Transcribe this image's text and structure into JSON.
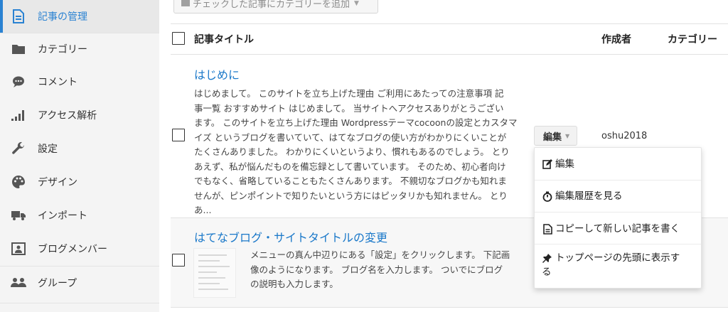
{
  "sidebar": {
    "items": [
      {
        "label": "記事の管理",
        "icon": "document-icon",
        "active": true
      },
      {
        "label": "カテゴリー",
        "icon": "folder-icon"
      },
      {
        "label": "コメント",
        "icon": "comment-icon"
      },
      {
        "label": "アクセス解析",
        "icon": "bar-chart-icon"
      },
      {
        "label": "設定",
        "icon": "wrench-icon"
      },
      {
        "label": "デザイン",
        "icon": "palette-icon"
      },
      {
        "label": "インポート",
        "icon": "truck-icon"
      },
      {
        "label": "ブログメンバー",
        "icon": "member-card-icon"
      },
      {
        "label": "グループ",
        "icon": "group-icon"
      }
    ]
  },
  "toolbar": {
    "bulk_category_label": "チェックした記事にカテゴリーを追加"
  },
  "table": {
    "columns": {
      "title": "記事タイトル",
      "author": "作成者",
      "category": "カテゴリー"
    },
    "rows": [
      {
        "title": "はじめに",
        "excerpt": [
          "はじめまして。 このサイトを立ち上げた理由 ご利用にあたっての注意事項 記",
          "事一覧 おすすめサイト はじめまして。 当サイトへアクセスありがとうござい",
          "ます。 このサイトを立ち上げた理由 Wordpressテーマcocoonの設定とカスタマ",
          "イズ というブログを書いていて、はてなブログの使い方がわかりにくいことが",
          "たくさんありました。 わかりにくいというより、慣れもあるのでしょう。 とり",
          "あえず、私が悩んだものを備忘録として書いています。 そのため、初心者向け",
          "でもなく、省略していることもたくさんあります。 不親切なブログかも知れま",
          "せんが、ピンポイントで知りたいという方にはピッタリかも知れません。 とり",
          "あ..."
        ],
        "author": "oshu2018",
        "edit_label": "編集"
      },
      {
        "title": "はてなブログ・サイトタイトルの変更",
        "excerpt": [
          "メニューの真ん中辺りにある「設定」をクリックします。 下記画",
          "像のようになります。 ブログ名を入力します。 ついでにブログ",
          "の説明も入力します。"
        ]
      }
    ]
  },
  "dropdown": {
    "items": [
      {
        "label": "編集",
        "icon": "edit-icon"
      },
      {
        "label": "編集履歴を見る",
        "icon": "stopwatch-icon"
      },
      {
        "label": "コピーして新しい記事を書く",
        "icon": "copy-document-icon"
      },
      {
        "label": "トップページの先頭に表示す",
        "label2": "る",
        "icon": "pin-icon"
      }
    ]
  },
  "colors": {
    "accent": "#2a82d2",
    "link": "#1a78c9",
    "sidebar_bg": "#f4f4f4"
  }
}
